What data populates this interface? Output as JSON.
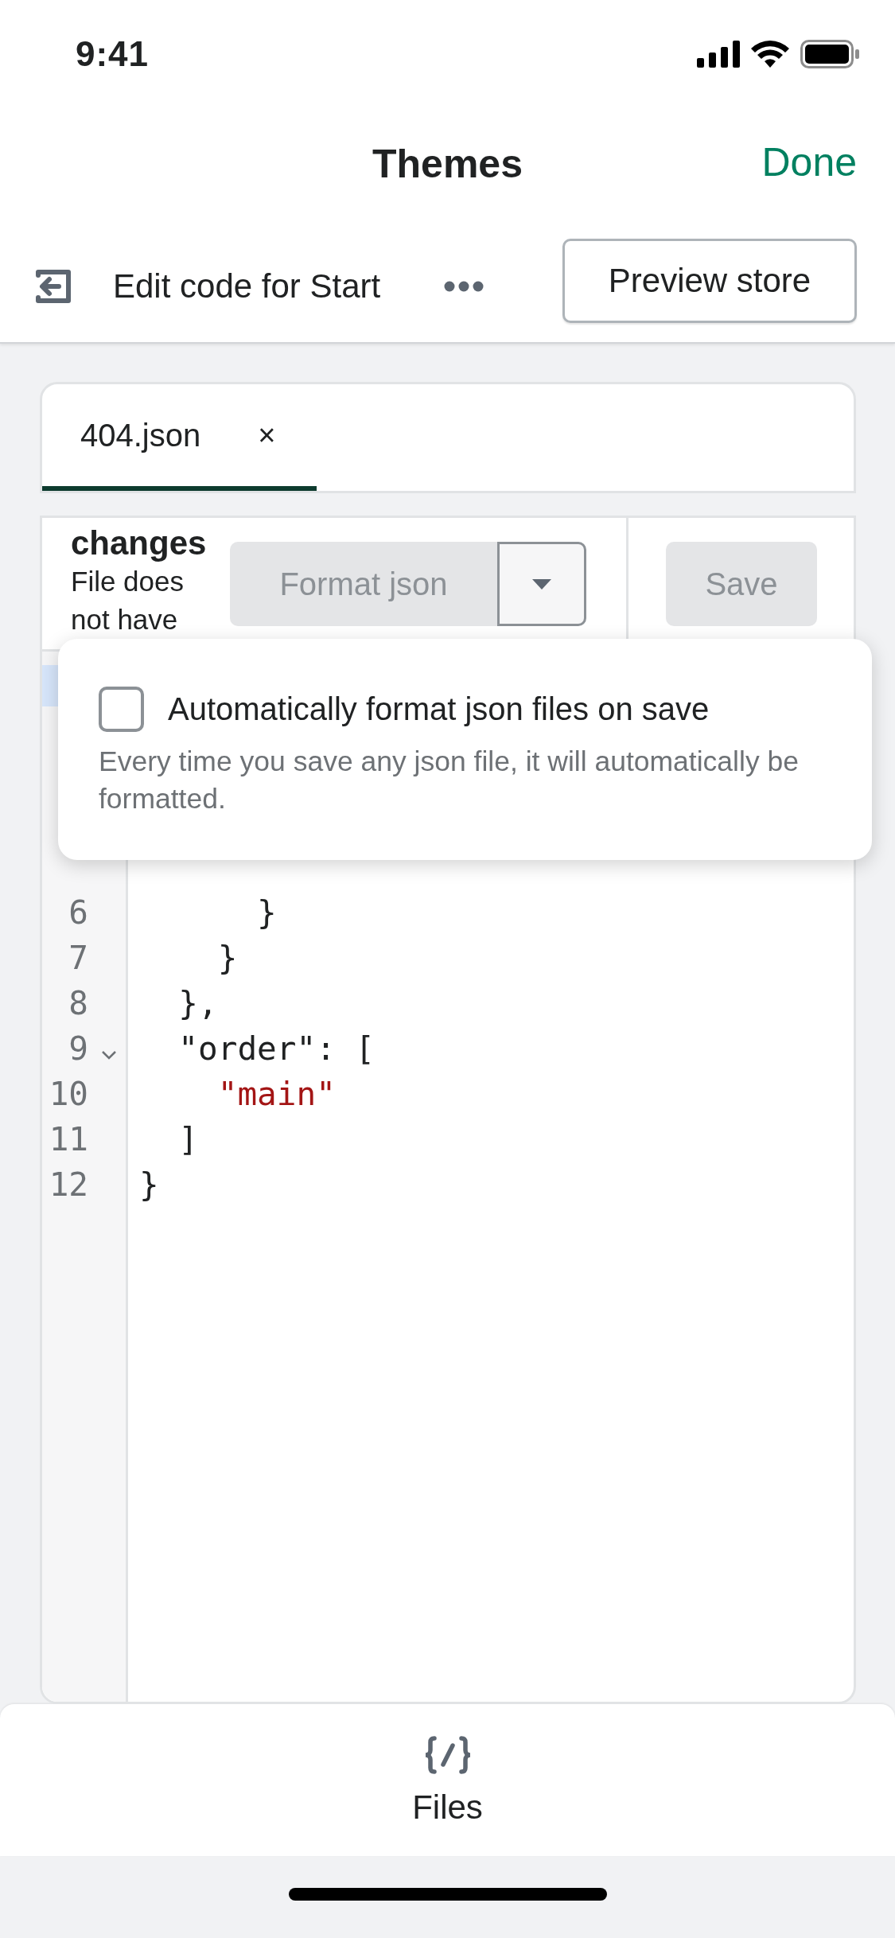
{
  "status_bar": {
    "time": "9:41"
  },
  "nav": {
    "title": "Themes",
    "done": "Done"
  },
  "toolbar": {
    "title": "Edit code for Start",
    "preview_button": "Preview store"
  },
  "tabs": [
    {
      "label": "404.json",
      "selected": true,
      "close": "×"
    }
  ],
  "editor_toolbar": {
    "status_title": "changes",
    "status_text": "File does not have",
    "format_button": {
      "label": "Format json",
      "disabled": true
    },
    "save_button": {
      "label": "Save",
      "disabled": true
    }
  },
  "popover": {
    "checkbox": {
      "label": "Automatically format json files on save",
      "checked": false
    },
    "description": "Every time you save any json file, it will automatically be formatted."
  },
  "code": {
    "lines": [
      {
        "number": "6",
        "text": "      }",
        "foldable": false,
        "kind": "plain"
      },
      {
        "number": "7",
        "text": "    }",
        "foldable": false,
        "kind": "plain"
      },
      {
        "number": "8",
        "text": "  },",
        "foldable": false,
        "kind": "plain"
      },
      {
        "number": "9",
        "text": "  \"order\": [",
        "foldable": true,
        "kind": "plain"
      },
      {
        "number": "10",
        "text": "    \"main\"",
        "foldable": false,
        "kind": "string"
      },
      {
        "number": "11",
        "text": "  ]",
        "foldable": false,
        "kind": "plain"
      },
      {
        "number": "12",
        "text": "}",
        "foldable": false,
        "kind": "plain"
      }
    ]
  },
  "bottom_tabs": [
    {
      "label": "Files"
    }
  ]
}
